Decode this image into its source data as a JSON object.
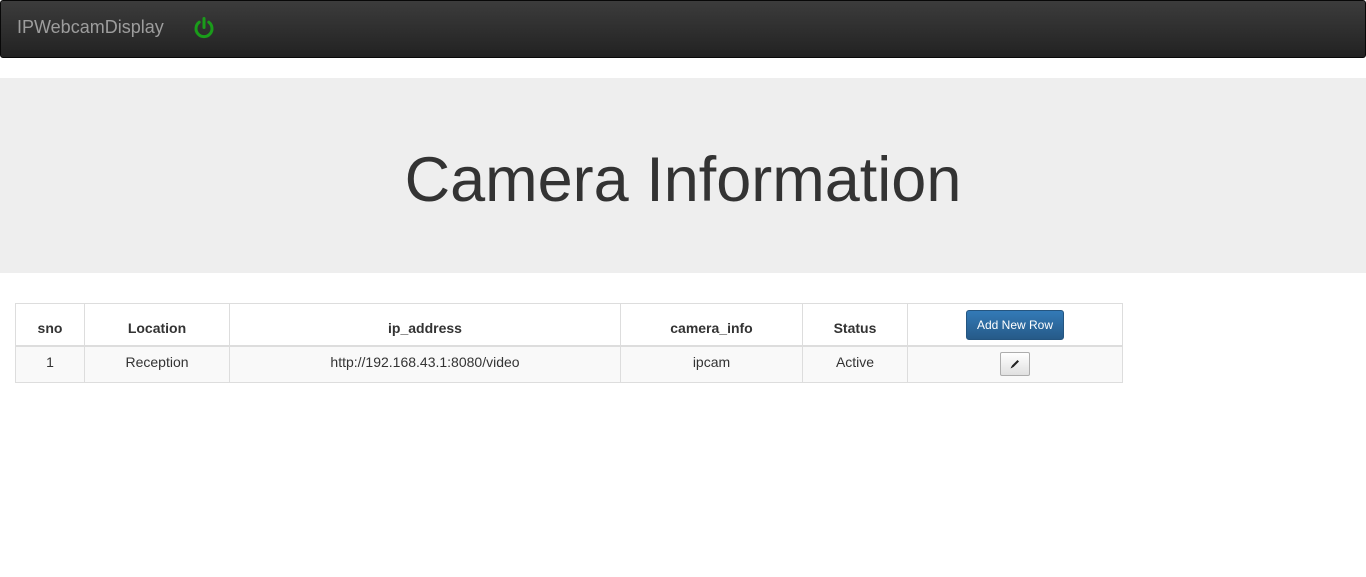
{
  "navbar": {
    "brand": "IPWebcamDisplay",
    "power_icon": "power-icon",
    "power_color": "#1a9c1a"
  },
  "jumbotron": {
    "title": "Camera Information"
  },
  "table": {
    "headers": {
      "sno": "sno",
      "location": "Location",
      "ip_address": "ip_address",
      "camera_info": "camera_info",
      "status": "Status"
    },
    "add_button_label": "Add New Row",
    "rows": [
      {
        "sno": "1",
        "location": "Reception",
        "ip_address": "http://192.168.43.1:8080/video",
        "camera_info": "ipcam",
        "status": "Active",
        "edit_icon": "pencil-icon"
      }
    ]
  }
}
